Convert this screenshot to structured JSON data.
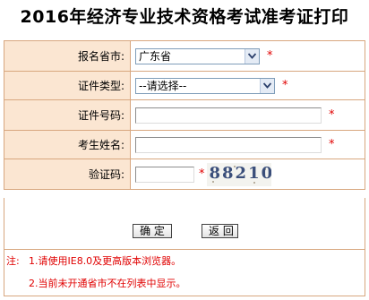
{
  "page": {
    "title": "2016年经济专业技术资格考试准考证打印"
  },
  "form": {
    "rows": [
      {
        "label": "报名省市:",
        "type": "select",
        "value": "广东省",
        "required_mark": "*"
      },
      {
        "label": "证件类型:",
        "type": "select",
        "value": "--请选择--",
        "required_mark": "*"
      },
      {
        "label": "证件号码:",
        "type": "text",
        "value": "",
        "required_mark": "*"
      },
      {
        "label": "考生姓名:",
        "type": "text",
        "value": "",
        "required_mark": "*"
      },
      {
        "label": "验证码:",
        "type": "captcha",
        "value": "",
        "required_mark": "*",
        "captcha_text": "88210"
      }
    ]
  },
  "buttons": {
    "confirm_label": "确 定",
    "back_label": "返 回"
  },
  "notes": {
    "prefix": "注:",
    "lines": [
      "1.请使用IE8.0及更高版本浏览器。",
      "2.当前未开通省市不在列表中显示。"
    ]
  },
  "colors": {
    "label_background": "#fbe6d2",
    "border": "#d8a77f",
    "required": "#e00000",
    "notes_text": "#e00000"
  },
  "icons": {
    "dropdown": "chevron-down-icon"
  }
}
